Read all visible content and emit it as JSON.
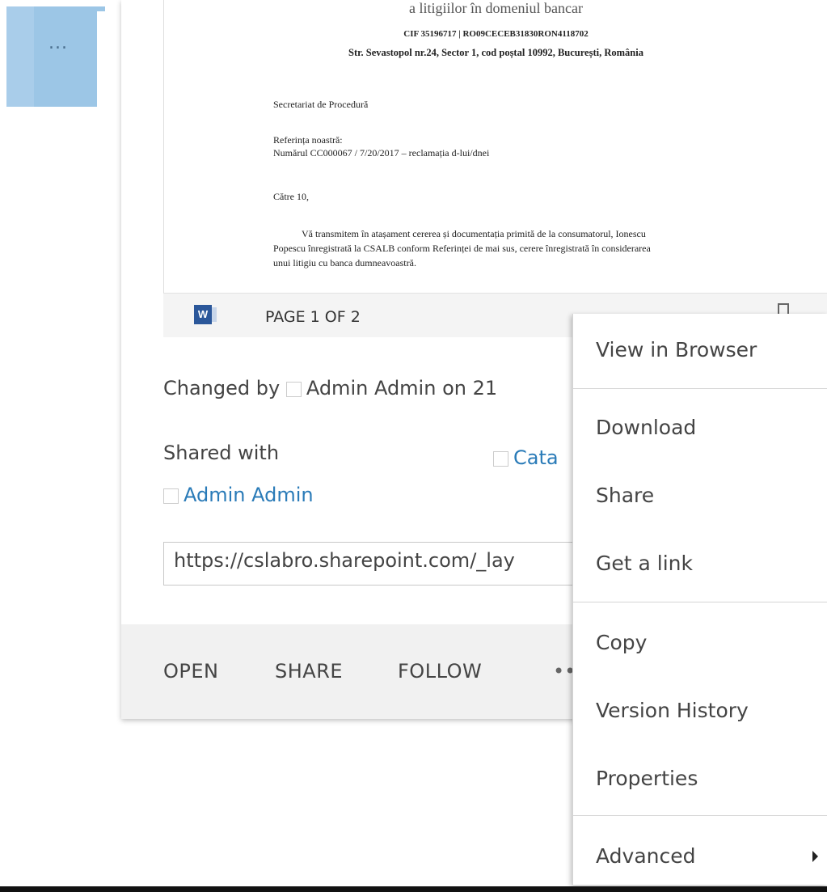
{
  "ellipsis_tile": {
    "label": "..."
  },
  "preview": {
    "doc_lines": {
      "heading_cut": "a litigiilor în domeniul bancar",
      "cif": "CIF 35196717 | RO09CECEB31830RON4118702",
      "address": "Str. Sevastopol nr.24, Sector 1, cod poștal 10992, București, România",
      "secretariat": "Secretariat de Procedură",
      "ref_label": "Referința noastră:",
      "ref_number": "Numărul CC000067 / 7/20/2017 – reclamația d-lui/dnei",
      "to": "Către 10,",
      "body1": "Vă transmitem în atașament cererea și documentația primită de la consumatorul, Ionescu",
      "body2": "Popescu înregistrată la CSALB conform Referinței de mai sus, cerere înregistrată în considerarea",
      "body3": "unui litigiu cu banca dumneavoastră."
    },
    "page_indicator": "PAGE 1 OF 2",
    "app_icon": "word-icon"
  },
  "meta": {
    "changed_by_label": "Changed by",
    "changed_by_value": "Admin Admin on 21",
    "shared_with_label": "Shared with",
    "shared_user_1": "Admin Admin",
    "shared_user_2": "Cata"
  },
  "url": "https://cslabro.sharepoint.com/_lay",
  "actions": {
    "open": "OPEN",
    "share": "SHARE",
    "follow": "FOLLOW",
    "more": "••"
  },
  "menu": {
    "items": [
      "View in Browser",
      "Download",
      "Share",
      "Get a link",
      "Copy",
      "Version History",
      "Properties",
      "Advanced"
    ]
  },
  "colors": {
    "tile": "#a9cdea",
    "link": "#2a7bb8",
    "word": "#2b579a"
  }
}
